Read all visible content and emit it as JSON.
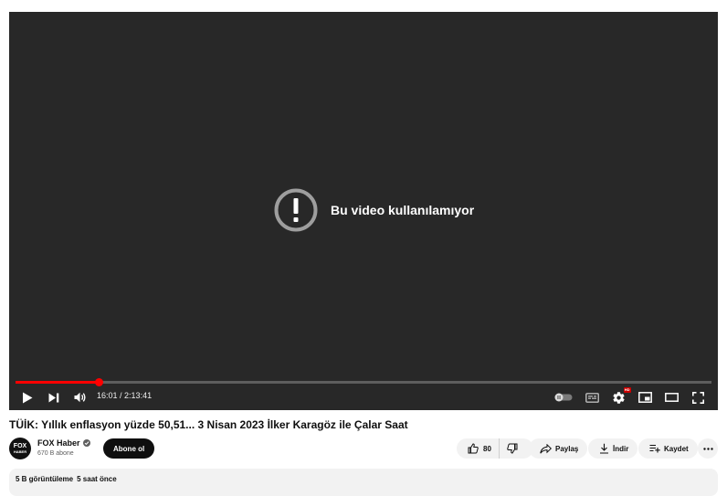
{
  "player": {
    "error_message": "Bu video kullanılamıyor",
    "current_time": "16:01",
    "time_separator": " / ",
    "duration": "2:13:41",
    "progress_fraction": 0.12,
    "accent_color": "#ff0000",
    "settings_badge": "HD",
    "icons": [
      "play-icon",
      "next-icon",
      "volume-icon",
      "autoplay-toggle-icon",
      "subtitles-icon",
      "settings-icon",
      "miniplayer-icon",
      "theater-icon",
      "fullscreen-icon"
    ]
  },
  "video": {
    "title": "TÜİK: Yıllık enflasyon yüzde 50,51... 3 Nisan 2023 İlker Karagöz ile Çalar Saat"
  },
  "channel": {
    "avatar_text_top": "FOX",
    "avatar_text_bottom": "HABER",
    "name": "FOX Haber",
    "subscribers": "670 B abone",
    "subscribe_label": "Abone ol"
  },
  "actions": {
    "like_count": "80",
    "share_label": "Paylaş",
    "download_label": "İndir",
    "save_label": "Kaydet"
  },
  "description": {
    "views": "5 B görüntüleme",
    "time_ago": "5 saat önce"
  }
}
